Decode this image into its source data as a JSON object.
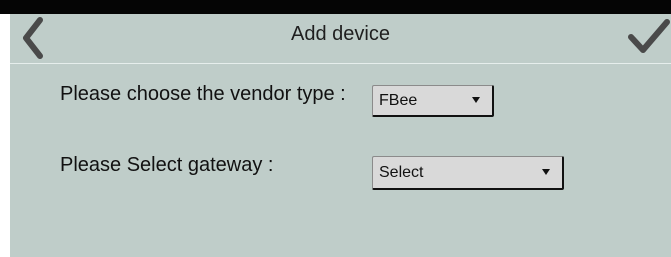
{
  "header": {
    "title": "Add device",
    "back_icon": "chevron-left-icon",
    "confirm_icon": "checkmark-icon"
  },
  "form": {
    "vendor_label": "Please choose the vendor type :",
    "vendor_value": "FBee",
    "gateway_label": "Please Select gateway :",
    "gateway_value": "Select"
  },
  "colors": {
    "background": "#bfcdc9",
    "select_bg": "#d9d9d9",
    "text": "#111111"
  }
}
